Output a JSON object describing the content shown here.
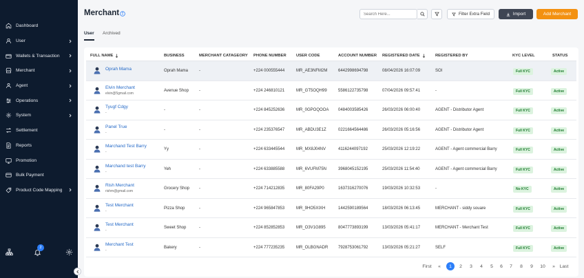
{
  "sidebar": {
    "items": [
      {
        "label": "Dashboard",
        "icon": "dashboard-icon",
        "chevron": false
      },
      {
        "label": "User",
        "icon": "user-icon",
        "chevron": true
      },
      {
        "label": "Wallets & Transaction",
        "icon": "wallet-icon",
        "chevron": true
      },
      {
        "label": "Merchant",
        "icon": "merchant-icon",
        "chevron": true
      },
      {
        "label": "Agent",
        "icon": "agent-icon",
        "chevron": true
      },
      {
        "label": "Operations",
        "icon": "operations-icon",
        "chevron": true
      },
      {
        "label": "System",
        "icon": "system-icon",
        "chevron": true
      },
      {
        "label": "Settlement",
        "icon": "settlement-icon",
        "chevron": false
      },
      {
        "label": "Reports",
        "icon": "reports-icon",
        "chevron": false
      },
      {
        "label": "Promotion",
        "icon": "promotion-icon",
        "chevron": false
      },
      {
        "label": "Bulk Payment",
        "icon": "bulk-payment-icon",
        "chevron": false
      },
      {
        "label": "Product Code Mapping",
        "icon": "product-code-icon",
        "chevron": true
      }
    ],
    "notification_count": "2"
  },
  "header": {
    "title": "Merchant",
    "search_placeholder": "Search Here...",
    "filter_extra_label": "Filter Extra Field",
    "import_label": "Import",
    "add_label": "Add Merchant"
  },
  "tabs": [
    "User",
    "Archived"
  ],
  "table": {
    "columns": [
      "FULL NAME",
      "BUSINESS",
      "MERCHANT CATAGEORY",
      "PHONE NUMBER",
      "USER CODE",
      "ACCOUNT NUMBER",
      "REGISTERED DATE",
      "REGISTERED BY",
      "KYC LEVEL",
      "STATUS"
    ],
    "rows": [
      {
        "name": "Oprah Mama",
        "sub": "",
        "business": "Oprah Mama",
        "category": "-",
        "phone": "+224 000555444",
        "code": "MR_AE3NFM2M",
        "account": "6442998694798",
        "date": "08/04/2026 16:07:09",
        "by": "SOI",
        "kyc": "Full KYC",
        "status": "Active"
      },
      {
        "name": "Elvin Merchant",
        "sub": "elvin@5gmail.com",
        "business": "Avenue Shop",
        "category": "-",
        "phone": "+224 246810121",
        "code": "MR_GT5OQH99",
        "account": "5586122735798",
        "date": "07/04/2026 09:57:41",
        "by": "-",
        "kyc": "Full KYC",
        "status": "Active"
      },
      {
        "name": "Tyugf Cdgy",
        "sub": "-",
        "business": "-",
        "category": "-",
        "phone": "+224 845252636",
        "code": "MR_0GPOQOOA",
        "account": "0484003585426",
        "date": "26/03/2026 06:00:40",
        "by": "AGENT - Distributor Agent",
        "kyc": "Full KYC",
        "status": "Active"
      },
      {
        "name": "Panel True",
        "sub": "-",
        "business": "-",
        "category": "-",
        "phone": "+224 235376547",
        "code": "MR_ABDU3E1Z",
        "account": "0221664564486",
        "date": "26/03/2026 05:16:56",
        "by": "AGENT - Distributor Agent",
        "kyc": "Full KYC",
        "status": "Active"
      },
      {
        "name": "Marchand Test Barry",
        "sub": "-",
        "business": "Yy",
        "category": "-",
        "phone": "+224 633445544",
        "code": "MR_MX8J04NV",
        "account": "4116244097192",
        "date": "25/03/2026 12:19:22",
        "by": "AGENT - Agent commercial Barry",
        "kyc": "Full KYC",
        "status": "Active"
      },
      {
        "name": "Marchand test Barry",
        "sub": "-",
        "business": "Yeh",
        "category": "-",
        "phone": "+224 633885588",
        "code": "MR_6VUFM75N",
        "account": "3968045152195",
        "date": "25/03/2026 11:54:40",
        "by": "AGENT - Agent commercial Barry",
        "kyc": "Full KYC",
        "status": "Active"
      },
      {
        "name": "Rish Merchant",
        "sub": "rishm@gmail.com",
        "business": "Grocery Shop",
        "category": "-",
        "phone": "+224 714212835",
        "code": "MR_80FA29P0",
        "account": "1637316270076",
        "date": "19/03/2026 10:32:53",
        "by": "-",
        "kyc": "No KYC",
        "status": "Active"
      },
      {
        "name": "Test Merchant",
        "sub": "-",
        "business": "Pizza Shop",
        "category": "-",
        "phone": "+224 965847853",
        "code": "MR_9HO5XIXH",
        "account": "1442590189564",
        "date": "18/03/2026 06:13:45",
        "by": "MERCHANT - siddy souare",
        "kyc": "Full KYC",
        "status": "Active"
      },
      {
        "name": "Test Merchant",
        "sub": "-",
        "business": "Sweet Shop",
        "category": "-",
        "phone": "+224 852852853",
        "code": "MR_O3V1G895",
        "account": "8047773893199",
        "date": "13/03/2026 05:41:17",
        "by": "MERCHANT - Merchant Test",
        "kyc": "Full KYC",
        "status": "Active"
      },
      {
        "name": "Merchant Test",
        "sub": "-",
        "business": "Bakery",
        "category": "-",
        "phone": "+224 777235235",
        "code": "MR_OLBGNADR",
        "account": "7928753061792",
        "date": "13/03/2026 05:21:27",
        "by": "SELF",
        "kyc": "Full KYC",
        "status": "Active"
      }
    ]
  },
  "pagination": {
    "first": "First",
    "prev": "«",
    "pages": [
      "1",
      "2",
      "3",
      "4",
      "5",
      "6",
      "7",
      "8",
      "9",
      "10"
    ],
    "next": "»",
    "last": "Last",
    "current": "1"
  },
  "colors": {
    "sidebar_bg": "#0d1b2e",
    "accent": "#f39111",
    "link": "#2469c7",
    "active_page": "#2d7ff9"
  }
}
